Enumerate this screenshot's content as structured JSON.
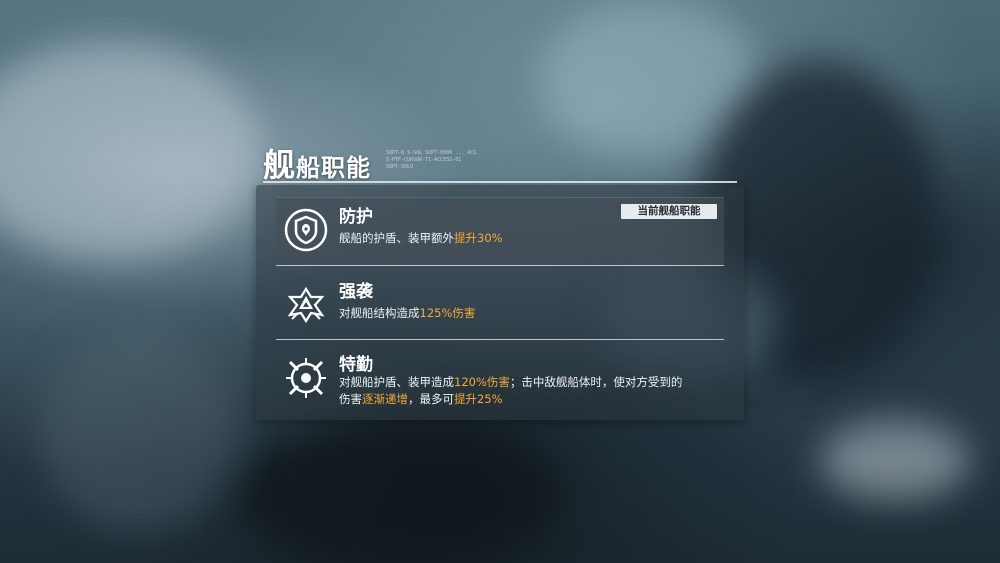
{
  "panel": {
    "title_big": "舰",
    "title_rest": "船职能",
    "deco_text": "SOPT-6 S-SOL SOPT-0000 ... ACS\nS-PTF-CURSOR-T1-ACCESS-01\nSOPT-SOLO"
  },
  "roles": [
    {
      "name": "防护",
      "icon": "shield-icon",
      "desc": [
        {
          "text": "舰船的护盾、装甲额外"
        },
        {
          "text": "提升30%",
          "hl": true
        }
      ],
      "current_tag": "当前舰船职能",
      "selected": true
    },
    {
      "name": "强袭",
      "icon": "assault-star-icon",
      "desc": [
        {
          "text": "对舰船结构造成"
        },
        {
          "text": "125%伤害",
          "hl": true
        }
      ]
    },
    {
      "name": "特勤",
      "icon": "crosshair-icon",
      "desc_line1": [
        {
          "text": "对舰船护盾、装甲造成"
        },
        {
          "text": "120%伤害",
          "hl": true
        },
        {
          "text": "；击中敌舰船体时，使对方受到的"
        }
      ],
      "desc_line2": [
        {
          "text": "伤害"
        },
        {
          "text": "逐渐递增",
          "hl": true
        },
        {
          "text": "，最多可"
        },
        {
          "text": "提升25%",
          "hl": true
        }
      ]
    }
  ],
  "colors": {
    "highlight": "#f4a93a",
    "tag_bg": "#e8ecef"
  }
}
